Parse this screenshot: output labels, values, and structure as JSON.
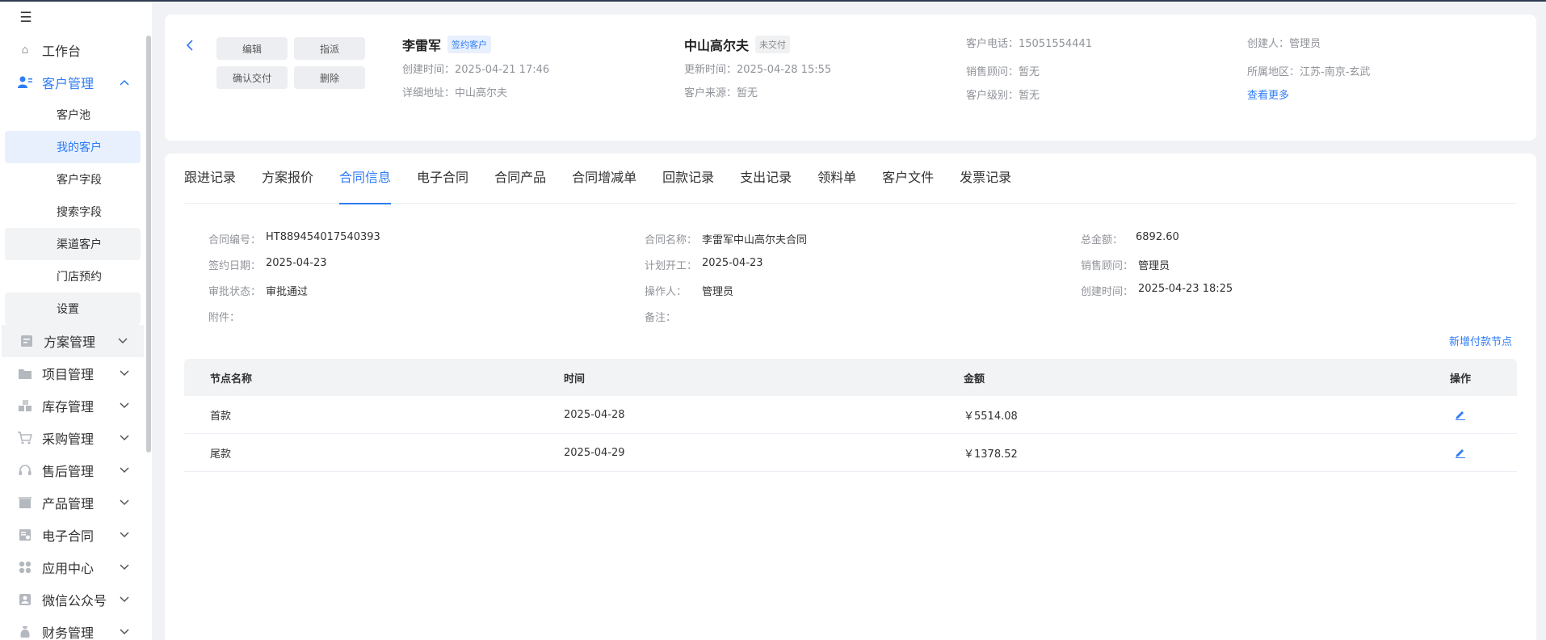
{
  "sidebar": {
    "collapse_icon": "menu-fold-icon",
    "items": [
      {
        "label": "工作台",
        "icon": "home-icon"
      },
      {
        "label": "客户管理",
        "icon": "user-manage-icon"
      },
      {
        "label": "方案管理",
        "icon": "plan-icon"
      },
      {
        "label": "项目管理",
        "icon": "folder-icon"
      },
      {
        "label": "库存管理",
        "icon": "inventory-icon"
      },
      {
        "label": "采购管理",
        "icon": "cart-icon"
      },
      {
        "label": "售后管理",
        "icon": "headset-icon"
      },
      {
        "label": "产品管理",
        "icon": "box-icon"
      },
      {
        "label": "电子合同",
        "icon": "contract-icon"
      },
      {
        "label": "应用中心",
        "icon": "apps-icon"
      },
      {
        "label": "微信公众号",
        "icon": "wechat-icon"
      },
      {
        "label": "财务管理",
        "icon": "finance-icon"
      }
    ],
    "sub_items": [
      "客户池",
      "我的客户",
      "客户字段",
      "搜索字段",
      "渠道客户",
      "门店预约",
      "设置"
    ]
  },
  "header": {
    "buttons": {
      "edit": "编辑",
      "assign": "指派",
      "confirm_delivery": "确认交付",
      "delete": "删除"
    },
    "customer_name": "李雷军",
    "customer_badge": "签约客户",
    "created_time": "创建时间：2025-04-21 17:46",
    "address": "详细地址：中山高尔夫",
    "project_name": "中山高尔夫",
    "project_badge": "未交付",
    "updated_time": "更新时间：2025-04-28 15:55",
    "source": "客户来源：暂无",
    "phone": "客户电话：15051554441",
    "sales_advisor": "销售顾问：暂无",
    "level": "客户级别：暂无",
    "creator": "创建人：管理员",
    "region": "所属地区：江苏-南京-玄武",
    "see_more": "查看更多"
  },
  "tabs": [
    "跟进记录",
    "方案报价",
    "合同信息",
    "电子合同",
    "合同产品",
    "合同增减单",
    "回款记录",
    "支出记录",
    "领料单",
    "客户文件",
    "发票记录"
  ],
  "active_tab": "合同信息",
  "contract": {
    "no_label": "合同编号：",
    "no_value": "HT889454017540393",
    "name_label": "合同名称：",
    "name_value": "李雷军中山高尔夫合同",
    "total_label": "总金额：",
    "total_value": "6892.60",
    "sign_label": "签约日期：",
    "sign_value": "2025-04-23",
    "start_label": "计划开工：",
    "start_value": "2025-04-23",
    "sales_label": "销售顾问：",
    "sales_value": "管理员",
    "approval_label": "审批状态：",
    "approval_value": "审批通过",
    "operator_label": "操作人：",
    "operator_value": "管理员",
    "created_label": "创建时间：",
    "created_value": "2025-04-23 18:25",
    "attach_label": "附件：",
    "remark_label": "备注："
  },
  "add_node": "新增付款节点",
  "table": {
    "headers": [
      "节点名称",
      "时间",
      "金额",
      "操作"
    ],
    "rows": [
      {
        "name": "首款",
        "date": "2025-04-28",
        "amount": "￥5514.08"
      },
      {
        "name": "尾款",
        "date": "2025-04-29",
        "amount": "￥1378.52"
      }
    ]
  },
  "colors": {
    "accent": "#2f7cf6",
    "sidebar_bg": "#ffffff",
    "page_bg": "#f0f2f5"
  }
}
